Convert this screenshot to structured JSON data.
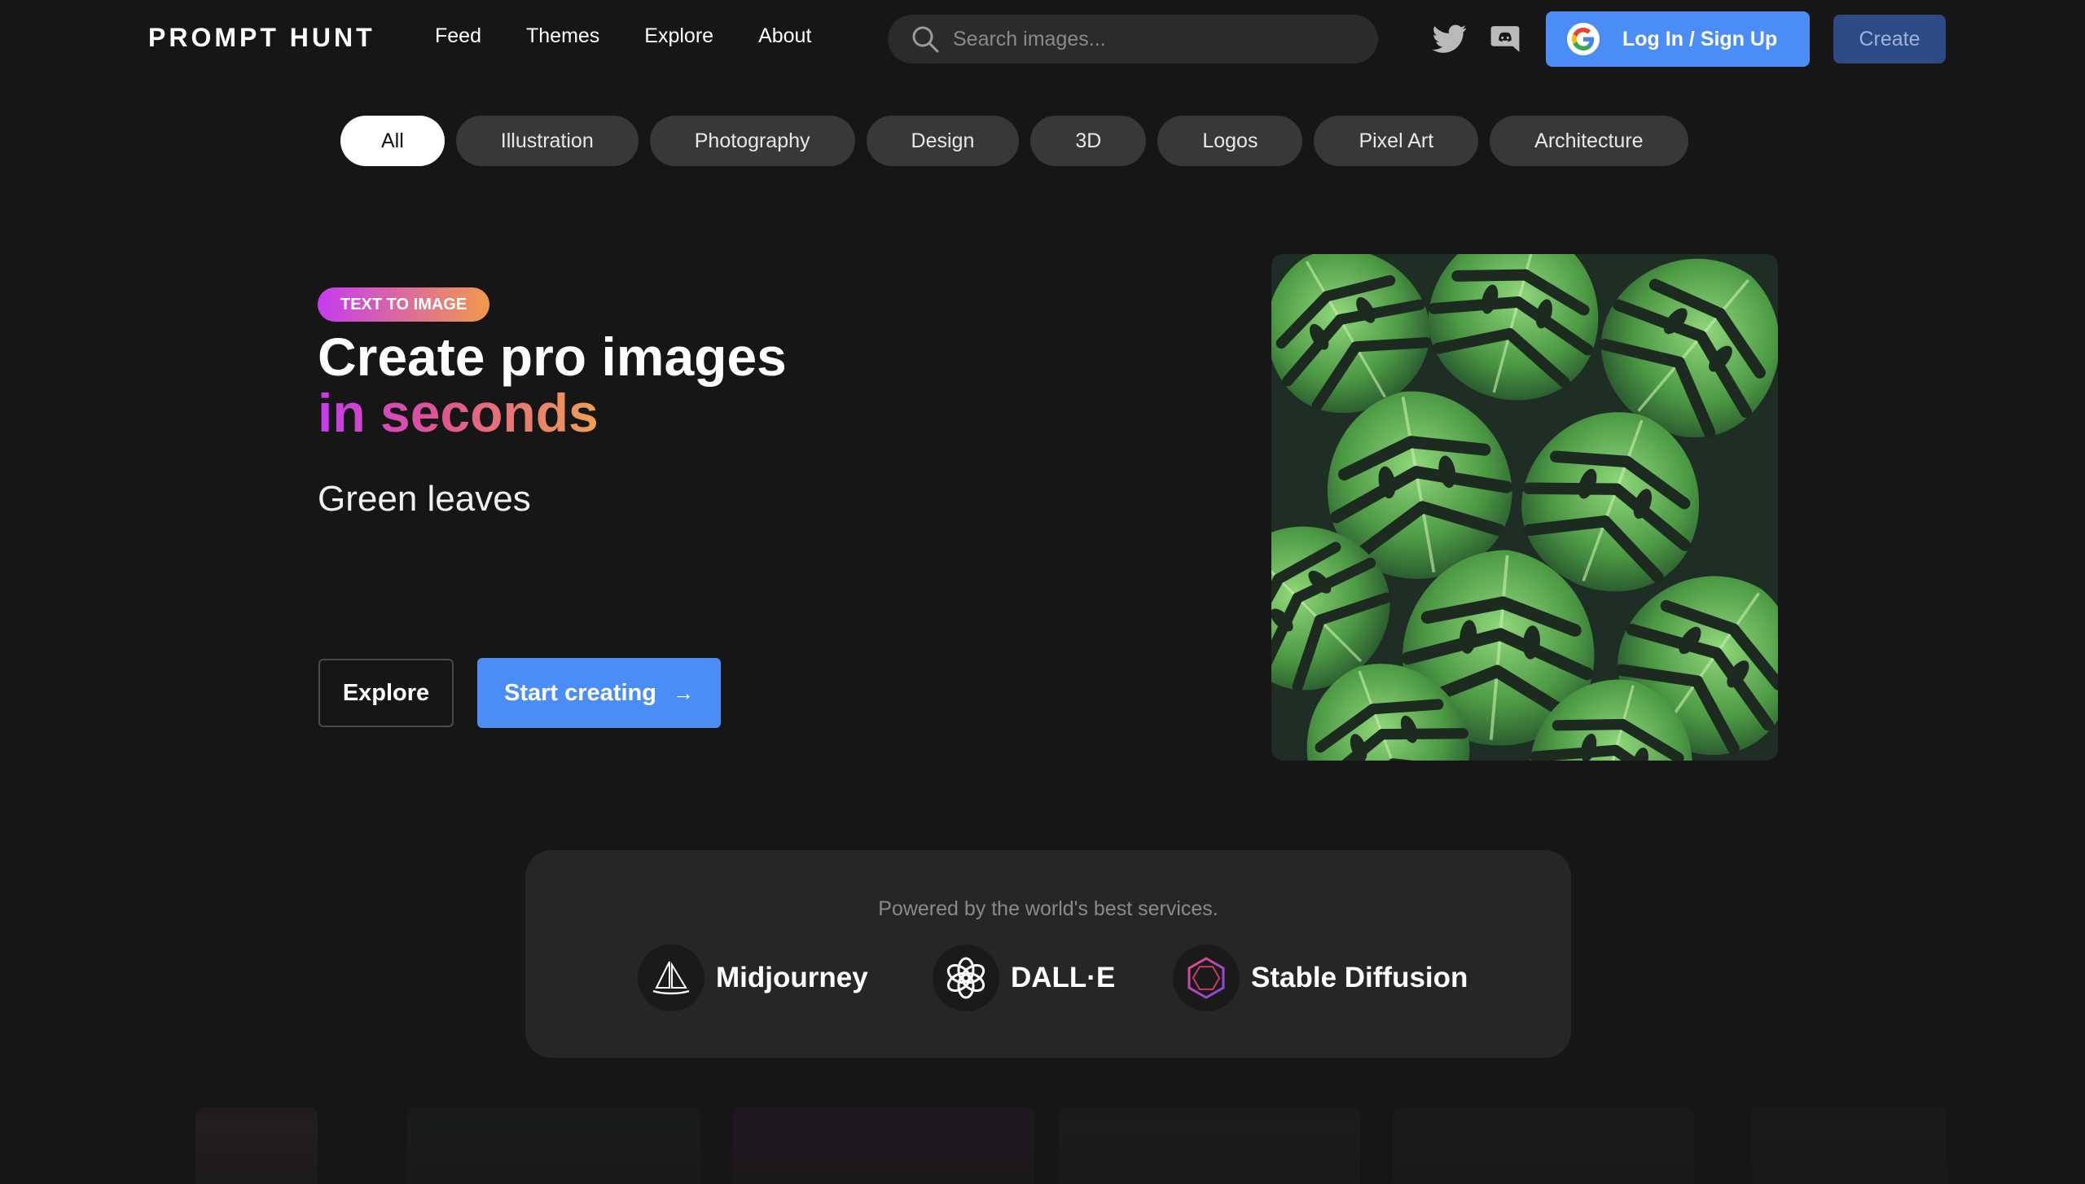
{
  "header": {
    "logo": "PROMPT HUNT",
    "nav": [
      {
        "label": "Feed"
      },
      {
        "label": "Themes"
      },
      {
        "label": "Explore"
      },
      {
        "label": "About"
      }
    ],
    "search": {
      "placeholder": "Search images..."
    },
    "social_icons": [
      "twitter-icon",
      "discord-icon"
    ],
    "login_label": "Log In / Sign Up",
    "create_label": "Create"
  },
  "categories": {
    "items": [
      "All",
      "Illustration",
      "Photography",
      "Design",
      "3D",
      "Logos",
      "Pixel Art",
      "Architecture"
    ],
    "selected": "All"
  },
  "hero": {
    "badge": "TEXT TO IMAGE",
    "title_line1": "Create pro images",
    "title_line2": "in seconds",
    "prompt": "Green leaves",
    "explore_label": "Explore",
    "start_label": "Start creating",
    "image_subject": "monstera leaves"
  },
  "powered": {
    "lead": "Powered by the world's best services.",
    "services": [
      {
        "name": "Midjourney",
        "icon": "midjourney-icon"
      },
      {
        "name": "DALL·E",
        "icon": "openai-icon"
      },
      {
        "name": "Stable Diffusion",
        "icon": "stable-diffusion-icon"
      }
    ]
  },
  "colors": {
    "background": "#161616",
    "accent_blue": "#4b8df7",
    "gradient_start": "#c63bf0",
    "gradient_end": "#f09a4a"
  }
}
